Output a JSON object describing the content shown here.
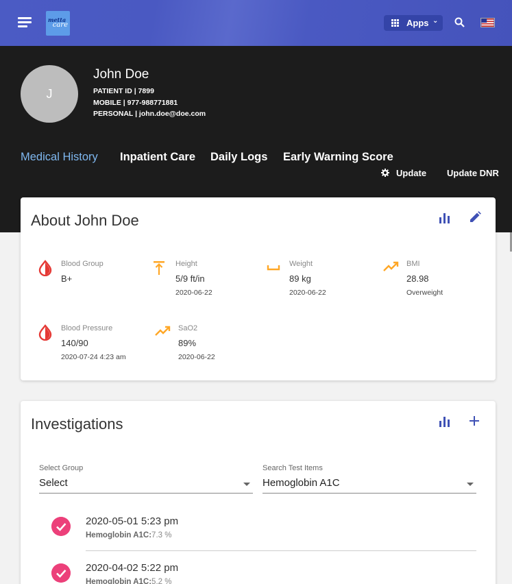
{
  "app": {
    "logo_line1": "metta",
    "logo_line2": "care",
    "apps_label": "Apps"
  },
  "patient": {
    "initial": "J",
    "name": "John Doe",
    "id_line": "PATIENT ID | 7899",
    "mobile_line": "MOBILE | 977-988771881",
    "personal_line": "PERSONAL | john.doe@doe.com"
  },
  "tabs": [
    {
      "label": "Medical History",
      "active": true
    },
    {
      "label": "Inpatient Care",
      "active": false
    },
    {
      "label": "Daily Logs",
      "active": false
    },
    {
      "label": "Early Warning Score",
      "active": false
    }
  ],
  "header_actions": {
    "update": "Update",
    "update_dnr": "Update DNR"
  },
  "about": {
    "title": "About John Doe",
    "vitals": [
      {
        "label": "Blood Group",
        "value": "B+",
        "sub": "",
        "icon": "blood-drop-icon"
      },
      {
        "label": "Height",
        "value": "5/9 ft/in",
        "sub": "2020-06-22",
        "icon": "height-icon"
      },
      {
        "label": "Weight",
        "value": "89 kg",
        "sub": "2020-06-22",
        "icon": "weight-icon"
      },
      {
        "label": "BMI",
        "value": "28.98",
        "sub": "Overweight",
        "icon": "trend-icon"
      },
      {
        "label": "Blood Pressure",
        "value": "140/90",
        "sub": "2020-07-24 4:23 am",
        "icon": "blood-drop-icon"
      },
      {
        "label": "SaO2",
        "value": "89%",
        "sub": "2020-06-22",
        "icon": "trend-icon"
      }
    ]
  },
  "investigations": {
    "title": "Investigations",
    "group_label": "Select Group",
    "group_value": "Select",
    "search_label": "Search Test Items",
    "search_value": "Hemoglobin A1C",
    "items": [
      {
        "date": "2020-05-01 5:23 pm",
        "test": "Hemoglobin A1C:",
        "result": "7.3 %"
      },
      {
        "date": "2020-04-02 5:22 pm",
        "test": "Hemoglobin A1C:",
        "result": "5.2 %"
      }
    ]
  },
  "colors": {
    "topbar": "#4a59c2",
    "accent": "#3f51b5",
    "active_tab": "#7fb8f0",
    "vital_red": "#e53935",
    "vital_orange": "#ffa726",
    "check_pink": "#ec407a"
  }
}
